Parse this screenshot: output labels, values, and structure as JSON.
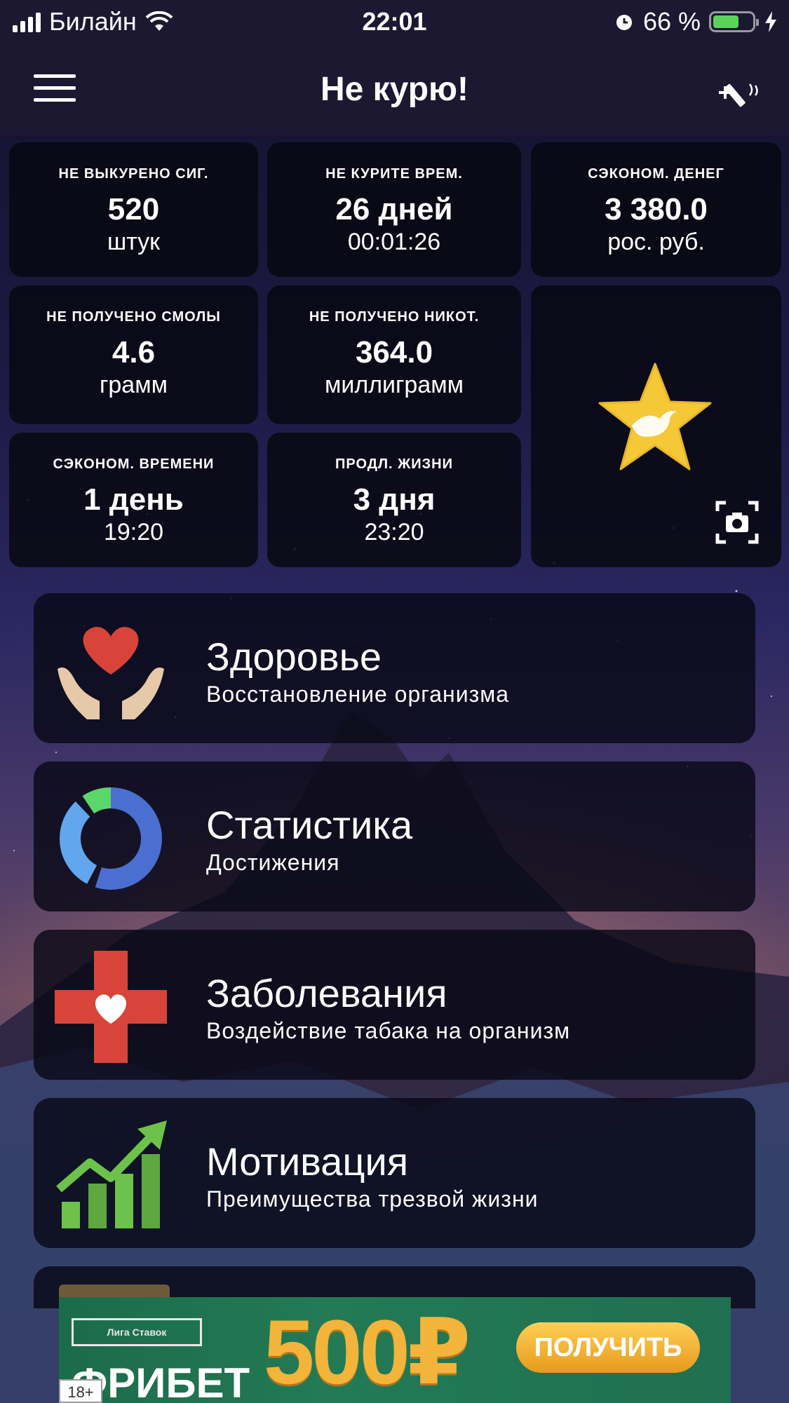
{
  "status_bar": {
    "carrier": "Билайн",
    "time": "22:01",
    "battery_percent": "66 %",
    "battery_level": 0.66
  },
  "nav": {
    "title": "Не курю!",
    "menu_icon": "hamburger-icon",
    "action_icon": "add-cigarette-icon"
  },
  "stats": [
    {
      "label": "НЕ ВЫКУРЕНО СИГ.",
      "value": "520",
      "unit": "штук"
    },
    {
      "label": "НЕ КУРИТЕ ВРЕМ.",
      "value": "26 дней",
      "unit": "00:01:26"
    },
    {
      "label": "СЭКОНОМ. ДЕНЕГ",
      "value": "3 380.0",
      "unit": "рос. руб."
    },
    {
      "label": "НЕ ПОЛУЧЕНО СМОЛЫ",
      "value": "4.6",
      "unit": "грамм"
    },
    {
      "label": "НЕ ПОЛУЧЕНО НИКОТ.",
      "value": "364.0",
      "unit": "миллиграмм"
    },
    {
      "label": "СЭКОНОМ. ВРЕМЕНИ",
      "value": "1 день",
      "unit": "19:20"
    },
    {
      "label": "ПРОДЛ. ЖИЗНИ",
      "value": "3 дня",
      "unit": "23:20"
    }
  ],
  "achievement": {
    "icon": "star-dove-icon",
    "screenshot_icon": "camera-icon"
  },
  "menu": [
    {
      "title": "Здоровье",
      "subtitle": "Восстановление организма",
      "icon": "heart-hands-icon"
    },
    {
      "title": "Статистика",
      "subtitle": "Достижения",
      "icon": "donut-chart-icon"
    },
    {
      "title": "Заболевания",
      "subtitle": "Воздействие табака на организм",
      "icon": "medical-cross-icon"
    },
    {
      "title": "Мотивация",
      "subtitle": "Преимущества трезвой жизни",
      "icon": "growth-chart-icon"
    }
  ],
  "ad": {
    "brand": "Лига Ставок",
    "headline": "ФРИБЕТ",
    "amount": "500₽",
    "button": "ПОЛУЧИТЬ",
    "age": "18+"
  },
  "colors": {
    "bar_bg": "#1c1832",
    "tile_bg": "#08080f",
    "heart": "#d9443a",
    "star": "#f5c837",
    "donut_blue": "#4f8fe6",
    "donut_green": "#5bd66a",
    "cross_red": "#d9443a",
    "growth_green": "#6cc24a",
    "ad_gold": "#f2b43a"
  }
}
